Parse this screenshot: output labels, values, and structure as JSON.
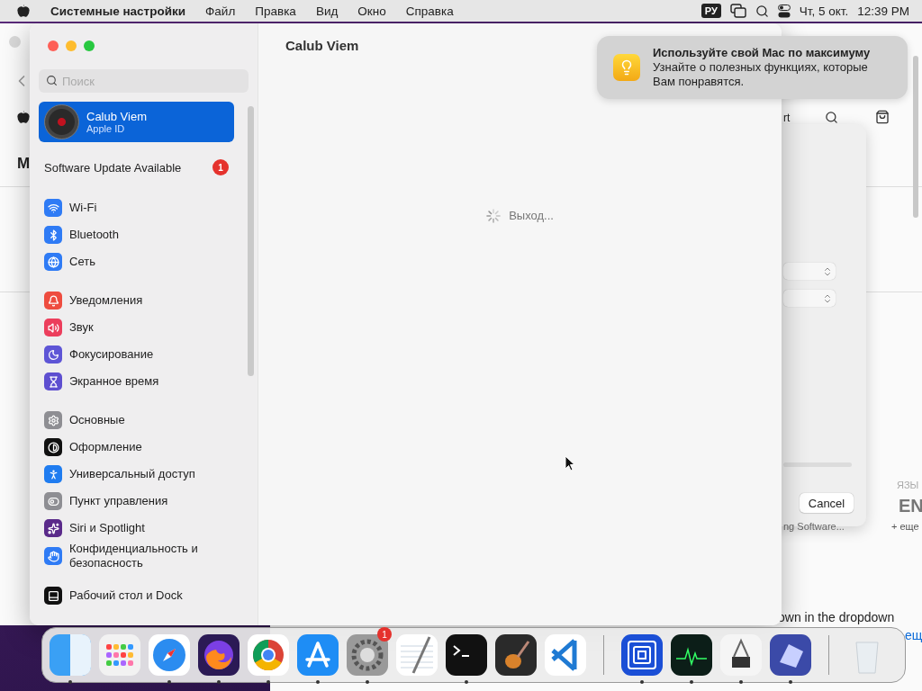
{
  "menu_bar": {
    "app": "Системные настройки",
    "menus": [
      "Файл",
      "Правка",
      "Вид",
      "Окно",
      "Справка"
    ],
    "input_source": "РУ",
    "date": "Чт, 5 окт.",
    "time": "12:39 PM"
  },
  "background_window": {
    "nav_fragment": "rt",
    "heading_fragment": "M",
    "language_label": "ЯЗЫ",
    "language_code": "EN",
    "more_link": "+ еще",
    "caption_fragment": "ng Software...",
    "text_fragment": "own in the dropdown",
    "link_fragment": "ещ",
    "sheet": {
      "cancel": "Cancel"
    }
  },
  "settings": {
    "search": {
      "placeholder": "Поиск"
    },
    "account": {
      "name": "Calub Viem",
      "subtitle": "Apple ID",
      "selected": true
    },
    "update": {
      "label": "Software Update Available",
      "badge": "1"
    },
    "groups": [
      [
        {
          "label": "Wi-Fi",
          "color": "#2f7bf5"
        },
        {
          "label": "Bluetooth",
          "color": "#2f7bf5"
        },
        {
          "label": "Сеть",
          "color": "#2f7bf5"
        }
      ],
      [
        {
          "label": "Уведомления",
          "color": "#ee4c3f"
        },
        {
          "label": "Звук",
          "color": "#ec3e5c"
        },
        {
          "label": "Фокусирование",
          "color": "#5e55d6"
        },
        {
          "label": "Экранное время",
          "color": "#5e4fd0"
        }
      ],
      [
        {
          "label": "Основные",
          "color": "#8e8e93"
        },
        {
          "label": "Оформление",
          "color": "#111111"
        },
        {
          "label": "Универсальный доступ",
          "color": "#1f7cf0"
        },
        {
          "label": "Пункт управления",
          "color": "#8e8e93"
        },
        {
          "label": "Siri и Spotlight",
          "color": "#5a2a8a"
        },
        {
          "label": "Конфиденциальность и безопасность",
          "color": "#2f7bf5"
        }
      ],
      [
        {
          "label": "Рабочий стол и Dock",
          "color": "#111111"
        }
      ]
    ],
    "content": {
      "title": "Calub Viem",
      "status": "Выход..."
    }
  },
  "notification": {
    "title": "Используйте свой Mac по максимуму",
    "body": "Узнайте о полезных функциях, которые Вам понравятся."
  },
  "dock": {
    "items": [
      {
        "running": true
      },
      {
        "running": false
      },
      {
        "running": true
      },
      {
        "running": true
      },
      {
        "running": true
      },
      {
        "running": true
      },
      {
        "running": true,
        "badge": "1"
      },
      {
        "running": false
      },
      {
        "running": true
      },
      {
        "running": false
      },
      {
        "running": false
      },
      {
        "running": true
      },
      {
        "running": true
      },
      {
        "running": true
      },
      {
        "running": true
      },
      {
        "running": false
      }
    ]
  }
}
